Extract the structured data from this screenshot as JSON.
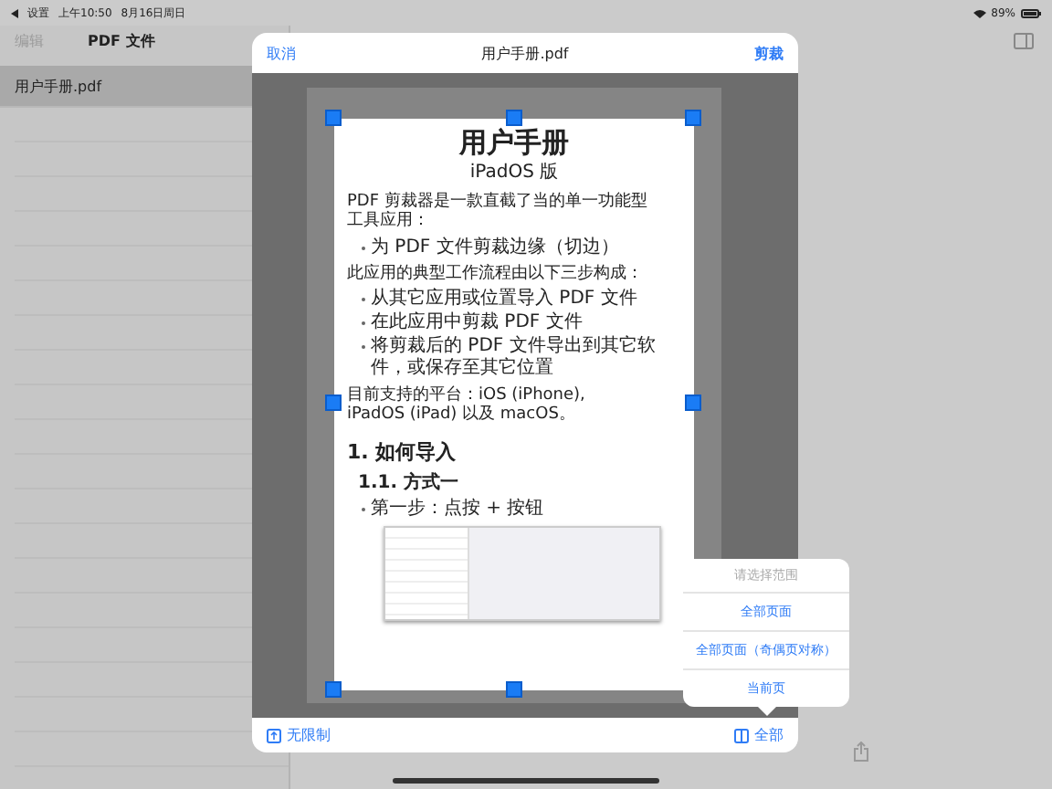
{
  "status_bar": {
    "back_label": "设置",
    "time": "上午10:50",
    "date": "8月16日周日",
    "battery": "89%"
  },
  "sidebar": {
    "edit": "编辑",
    "title": "PDF 文件",
    "files": [
      {
        "name": "用户手册.pdf",
        "selected": true
      }
    ]
  },
  "dialog": {
    "cancel": "取消",
    "title": "用户手册.pdf",
    "confirm": "剪裁",
    "document": {
      "title": "用户手册",
      "subtitle": "iPadOS 版",
      "blocks": [
        {
          "kind": "para",
          "text": "PDF 剪裁器是一款直截了当的单一功能型工具应用："
        },
        {
          "kind": "bullet",
          "text": "为 PDF 文件剪裁边缘（切边）"
        },
        {
          "kind": "para",
          "text": "此应用的典型工作流程由以下三步构成："
        },
        {
          "kind": "bullet",
          "text": "从其它应用或位置导入 PDF 文件"
        },
        {
          "kind": "bullet",
          "text": "在此应用中剪裁 PDF 文件"
        },
        {
          "kind": "bullet",
          "text": "将剪裁后的 PDF 文件导出到其它软件，或保存至其它位置"
        },
        {
          "kind": "para",
          "text": "目前支持的平台：iOS (iPhone), iPadOS (iPad) 以及 macOS。"
        },
        {
          "kind": "h1",
          "text": "1.   如何导入"
        },
        {
          "kind": "h2",
          "text": "1.1. 方式一"
        },
        {
          "kind": "bullet",
          "text": "第一步：点按 + 按钮"
        },
        {
          "kind": "image"
        }
      ]
    },
    "footer": {
      "aspect": "无限制",
      "pages": "全部"
    }
  },
  "popover": {
    "title": "请选择范围",
    "options": [
      {
        "label": "全部页面"
      },
      {
        "label": "全部页面（奇偶页对称）"
      },
      {
        "label": "当前页"
      }
    ]
  }
}
